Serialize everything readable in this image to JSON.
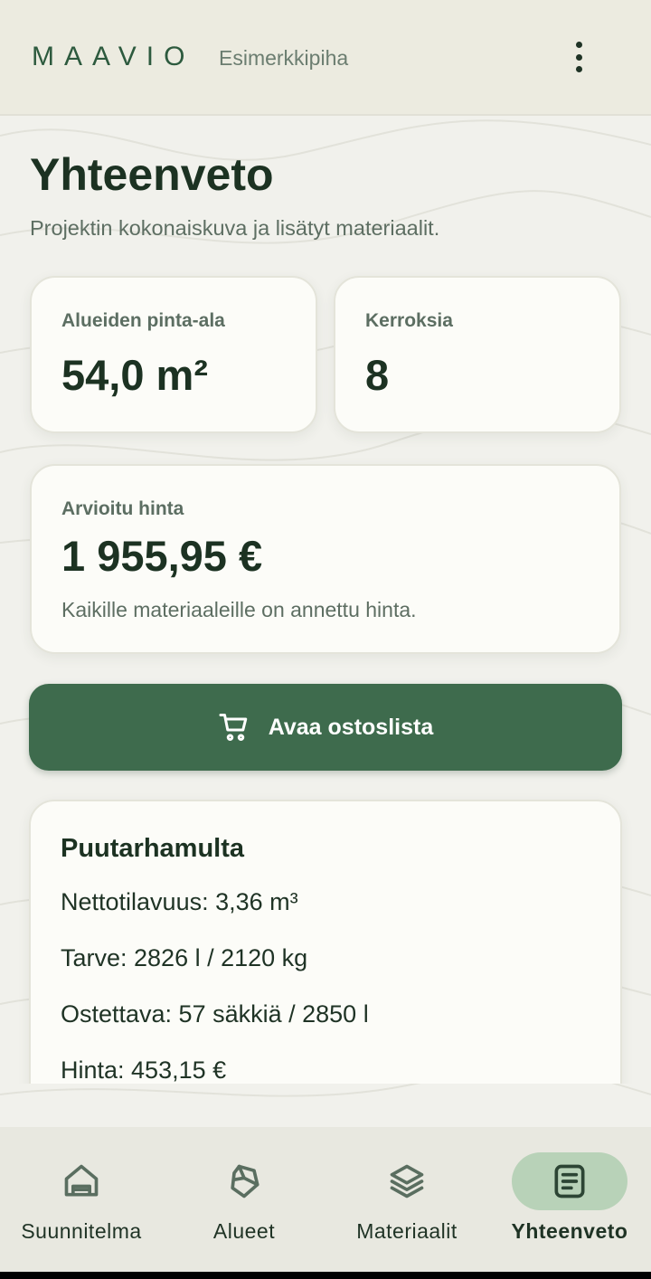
{
  "header": {
    "brand": "MAAVIO",
    "project_name": "Esimerkkipiha",
    "menu_icon": "more-vertical-icon"
  },
  "page": {
    "title": "Yhteenveto",
    "subtitle": "Projektin kokonaiskuva ja lisätyt materiaalit."
  },
  "stats": {
    "area_label": "Alueiden pinta-ala",
    "area_value": "54,0 m²",
    "layers_label": "Kerroksia",
    "layers_value": "8"
  },
  "price": {
    "label": "Arvioitu hinta",
    "value": "1 955,95 €",
    "note": "Kaikille materiaaleille on annettu hinta."
  },
  "shopping": {
    "button_label": "Avaa ostoslista",
    "icon": "shopping-cart-icon"
  },
  "materials": [
    {
      "name": "Puutarhamulta",
      "lines": [
        "Nettotilavuus: 3,36 m³",
        "Tarve: 2826 l / 2120 kg",
        "Ostettava: 57 säkkiä / 2850 l",
        "Hinta: 453,15 €"
      ]
    }
  ],
  "nav": {
    "items": [
      {
        "label": "Suunnitelma",
        "icon": "house-icon",
        "active": false
      },
      {
        "label": "Alueet",
        "icon": "area-polygon-icon",
        "active": false
      },
      {
        "label": "Materiaalit",
        "icon": "layers-icon",
        "active": false
      },
      {
        "label": "Yhteenveto",
        "icon": "document-icon",
        "active": true
      }
    ]
  },
  "colors": {
    "accent": "#3e6b4d",
    "nav_active": "#b8d2b8",
    "text_dark": "#1c3222"
  }
}
